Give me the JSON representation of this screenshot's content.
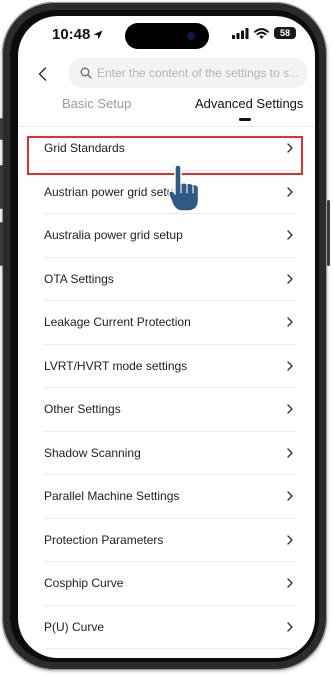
{
  "status_bar": {
    "time": "10:48",
    "battery": "58"
  },
  "search": {
    "placeholder": "Enter the content of the settings to s..."
  },
  "tabs": [
    {
      "label": "Basic Setup"
    },
    {
      "label": "Advanced Settings"
    }
  ],
  "settings": [
    {
      "label": "Grid Standards"
    },
    {
      "label": "Austrian power grid setup"
    },
    {
      "label": "Australia power grid setup"
    },
    {
      "label": "OTA Settings"
    },
    {
      "label": "Leakage Current Protection"
    },
    {
      "label": "LVRT/HVRT mode settings"
    },
    {
      "label": "Other Settings"
    },
    {
      "label": "Shadow Scanning"
    },
    {
      "label": "Parallel Machine Settings"
    },
    {
      "label": "Protection Parameters"
    },
    {
      "label": "Cosphip Curve"
    },
    {
      "label": "P(U) Curve"
    }
  ],
  "colors": {
    "highlight": "#e03131",
    "cursor_fill": "#2f5a86"
  }
}
